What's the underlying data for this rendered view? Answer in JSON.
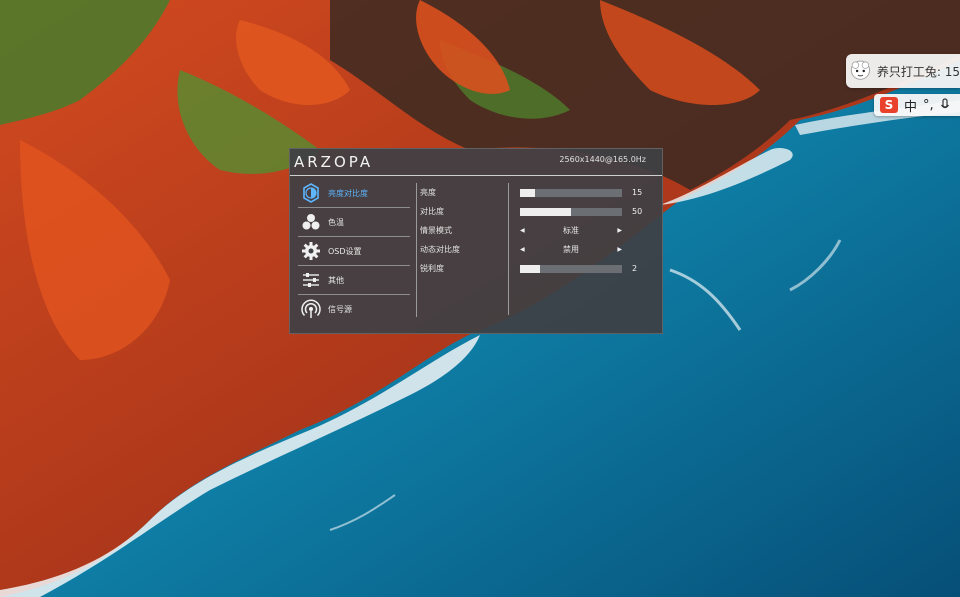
{
  "colors": {
    "panel_bg": "#3e4044",
    "accent_active": "#5db6ff",
    "bar_fill": "#eeeeee",
    "bar_track": "#6b6e73",
    "ocean": "#0d6f93",
    "cliff_red": "#c2411c"
  },
  "pet_widget": {
    "avatar_icon": "sheep-mascot-icon",
    "text": "养只打工兔: 15"
  },
  "ime_bar": {
    "logo": "S",
    "mode": "中",
    "punct": "°,",
    "mic_icon": "microphone-icon"
  },
  "osd": {
    "brand": "ARZOPA",
    "resolution": "2560x1440@165.0Hz",
    "menu": [
      {
        "label": "亮度对比度",
        "icon": "brightness-icon",
        "active": true
      },
      {
        "label": "色温",
        "icon": "color-dots-icon",
        "active": false
      },
      {
        "label": "OSD设置",
        "icon": "gear-icon",
        "active": false
      },
      {
        "label": "其他",
        "icon": "sliders-icon",
        "active": false
      },
      {
        "label": "信号源",
        "icon": "signal-icon",
        "active": false
      }
    ],
    "params": [
      {
        "label": "亮度",
        "type": "bar",
        "value": 15,
        "max": 100
      },
      {
        "label": "对比度",
        "type": "bar",
        "value": 50,
        "max": 100
      },
      {
        "label": "情景模式",
        "type": "select",
        "value": "标准"
      },
      {
        "label": "动态对比度",
        "type": "select",
        "value": "禁用"
      },
      {
        "label": "锐利度",
        "type": "bar",
        "value": 2,
        "max": 10
      }
    ]
  }
}
